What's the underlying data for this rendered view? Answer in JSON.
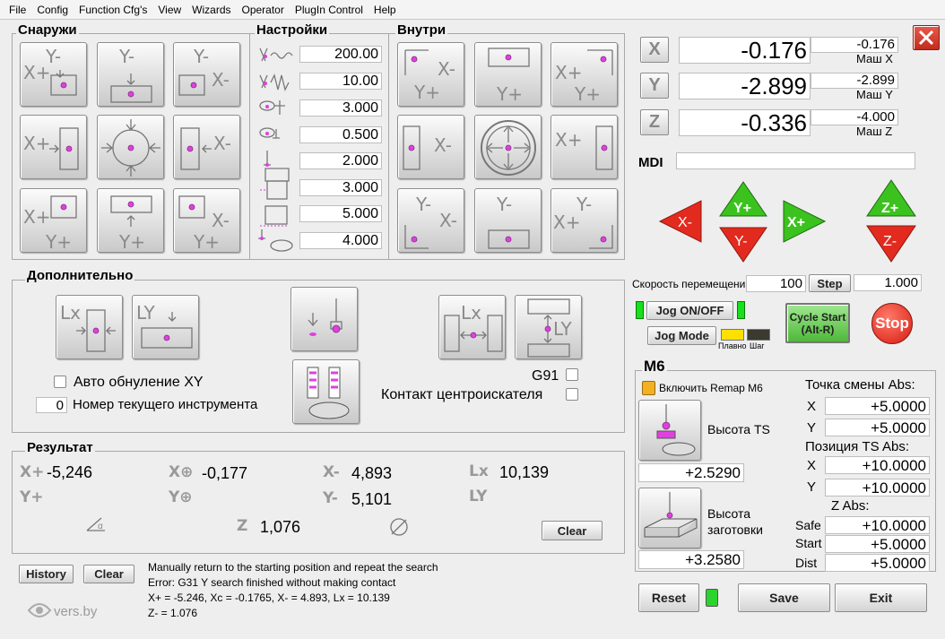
{
  "menu": [
    "File",
    "Config",
    "Function Cfg's",
    "View",
    "Wizards",
    "Operator",
    "PlugIn Control",
    "Help"
  ],
  "sections": {
    "outside": "Снаружи",
    "settings": "Настройки",
    "inside": "Внутри",
    "extra": "Дополнительно",
    "result": "Результат",
    "m6": "M6"
  },
  "settings_values": [
    "200.00",
    "10.00",
    "3.000",
    "0.500",
    "2.000",
    "3.000",
    "5.000",
    "4.000"
  ],
  "dro": {
    "x": {
      "label": "X",
      "value": "-0.176",
      "mach_value": "-0.176",
      "mach_label": "Маш X"
    },
    "y": {
      "label": "Y",
      "value": "-2.899",
      "mach_value": "-2.899",
      "mach_label": "Маш Y"
    },
    "z": {
      "label": "Z",
      "value": "-0.336",
      "mach_value": "-4.000",
      "mach_label": "Маш Z"
    }
  },
  "mdi": {
    "label": "MDI",
    "value": ""
  },
  "jog": {
    "x_minus": "X-",
    "x_plus": "X+",
    "y_plus": "Y+",
    "y_minus": "Y-",
    "z_plus": "Z+",
    "z_minus": "Z-",
    "speed_label": "Скорость перемещений",
    "speed_value": "100",
    "step_label": "Step",
    "step_value": "1.000",
    "onoff_label": "Jog ON/OFF",
    "mode_label": "Jog Mode",
    "smooth_label": "Плавно",
    "step_mode_label": "Шаг",
    "cycle_start": "Cycle Start",
    "cycle_start_hint": "(Alt-R)",
    "stop": "Stop"
  },
  "extra": {
    "auto_zero": "Авто обнуление XY",
    "tool_number": "0",
    "tool_label": "Номер текущего инструмента",
    "g91": "G91",
    "probe_contact": "Контакт центроискателя"
  },
  "result": {
    "xplus": "-5,246",
    "xc": "-0,177",
    "xminus": "4,893",
    "lx": "10,139",
    "yminus": "5,101",
    "z": "1,076",
    "clear": "Clear"
  },
  "log": {
    "history": "History",
    "clear": "Clear",
    "lines": [
      "Manually return to the starting position and repeat the search",
      "Error: G31 Y search finished without making contact",
      "X+ = -5.246, Xc = -0.1765, X- = 4.893, Lx = 10.139",
      "Z- = 1.076"
    ],
    "watermark": "vers.by"
  },
  "m6": {
    "remap_label": "Включить Remap M6",
    "ts_height_label": "Высота TS",
    "ts_height_value": "+2.5290",
    "workpiece_height_label1": "Высота",
    "workpiece_height_label2": "заготовки",
    "workpiece_height_value": "+3.2580",
    "change_point_label": "Точка смены Abs:",
    "cp_x_label": "X",
    "cp_x": "+5.0000",
    "cp_y_label": "Y",
    "cp_y": "+5.0000",
    "ts_pos_label": "Позиция TS Abs:",
    "ts_x_label": "X",
    "ts_x": "+10.0000",
    "ts_y_label": "Y",
    "ts_y": "+10.0000",
    "z_abs_label": "Z Abs:",
    "safe_label": "Safe",
    "safe": "+10.0000",
    "start_label": "Start",
    "start": "+5.0000",
    "dist_label": "Dist",
    "dist": "+5.0000"
  },
  "bottom": {
    "reset": "Reset",
    "save": "Save",
    "exit": "Exit"
  },
  "colors": {
    "red": "#e32a1e",
    "green": "#3cc21f",
    "jog_led": "#18e01a",
    "yellow": "#ffe000",
    "probe_dot": "#e040e0"
  }
}
